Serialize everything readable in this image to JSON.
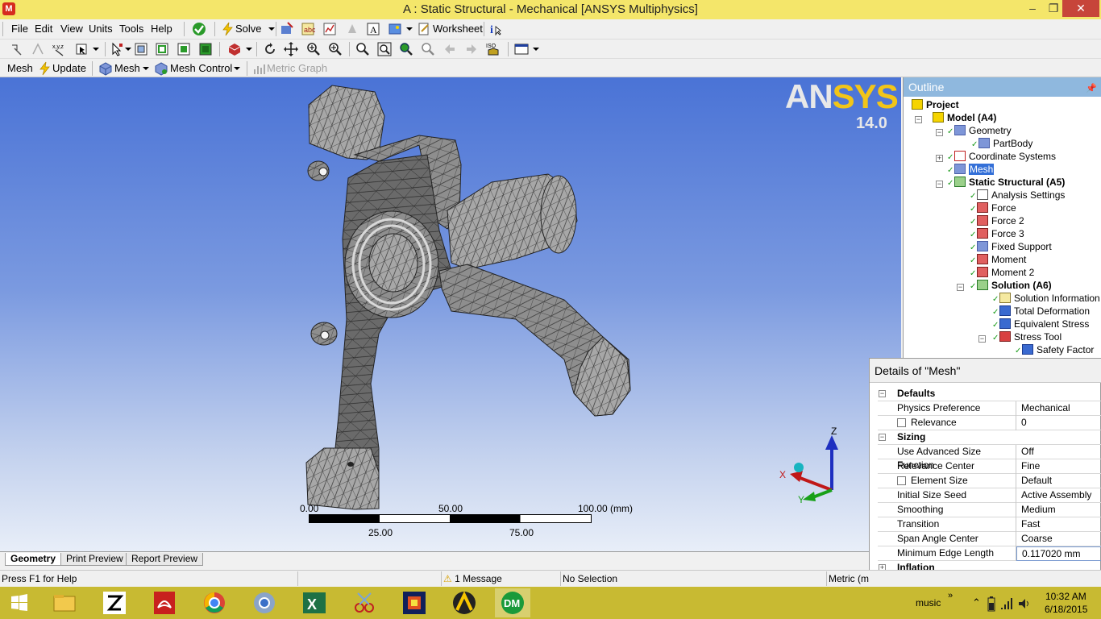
{
  "window": {
    "title": "A : Static Structural - Mechanical [ANSYS Multiphysics]",
    "minimize": "–",
    "maximize": "❐",
    "close": "✕"
  },
  "menu": {
    "items": [
      "File",
      "Edit",
      "View",
      "Units",
      "Tools",
      "Help"
    ],
    "solve_label": "Solve",
    "worksheet_label": "Worksheet"
  },
  "mesh_toolbar": {
    "context_label": "Mesh",
    "update_label": "Update",
    "mesh_label": "Mesh",
    "mesh_control_label": "Mesh Control",
    "metric_graph_label": "Metric Graph"
  },
  "viewport": {
    "brand": "ANSYS",
    "brand_an": "AN",
    "brand_sys": "SYS",
    "version": "14.0",
    "scale": {
      "labels_top": [
        "0.00",
        "50.00",
        "100.00 (mm)"
      ],
      "labels_bottom": [
        "25.00",
        "75.00"
      ]
    },
    "triad": {
      "x": "X",
      "y": "Y",
      "z": "Z"
    }
  },
  "tabs": [
    "Geometry",
    "Print Preview",
    "Report Preview"
  ],
  "status": {
    "help": "Press F1 for Help",
    "messages": "1 Message",
    "selection": "No Selection",
    "units": "Metric (m"
  },
  "outline": {
    "title": "Outline",
    "tree": [
      "Project",
      "Model (A4)",
      "Geometry",
      "PartBody",
      "Coordinate Systems",
      "Mesh",
      "Static Structural (A5)",
      "Analysis Settings",
      "Force",
      "Force 2",
      "Force 3",
      "Fixed Support",
      "Moment",
      "Moment 2",
      "Solution (A6)",
      "Solution Information",
      "Total Deformation",
      "Equivalent Stress",
      "Stress Tool",
      "Safety Factor"
    ]
  },
  "details": {
    "title": "Details of \"Mesh\"",
    "groups": {
      "defaults": "Defaults",
      "sizing": "Sizing",
      "inflation": "Inflation"
    },
    "rows": [
      {
        "key": "Physics Preference",
        "value": "Mechanical"
      },
      {
        "key": "Relevance",
        "value": "0"
      },
      {
        "key": "Use Advanced Size Function",
        "value": "Off"
      },
      {
        "key": "Relevance Center",
        "value": "Fine"
      },
      {
        "key": "Element Size",
        "value": "Default"
      },
      {
        "key": "Initial Size Seed",
        "value": "Active Assembly"
      },
      {
        "key": "Smoothing",
        "value": "Medium"
      },
      {
        "key": "Transition",
        "value": "Fast"
      },
      {
        "key": "Span Angle Center",
        "value": "Coarse"
      },
      {
        "key": "Minimum Edge Length",
        "value": "0.117020 mm"
      }
    ]
  },
  "taskbar": {
    "music_label": "music",
    "time": "10:32 AM",
    "date": "6/18/2015",
    "dm_label": "DM",
    "ansys_label": "A"
  }
}
